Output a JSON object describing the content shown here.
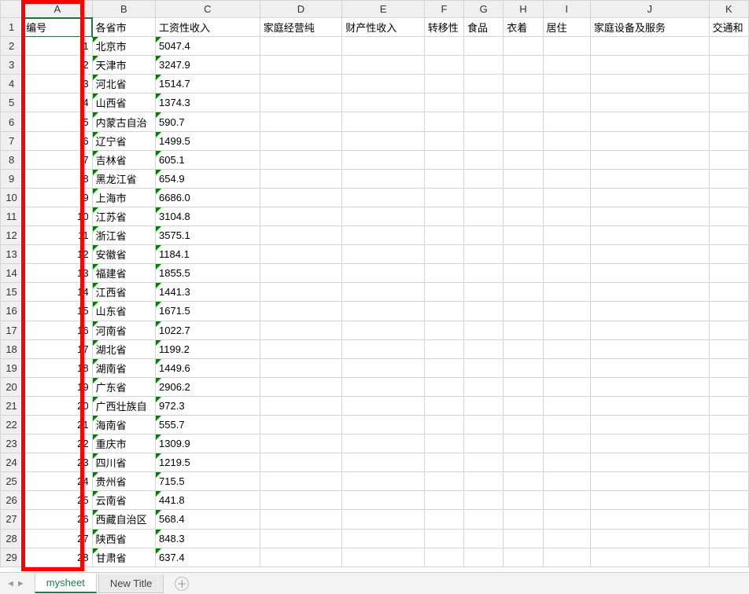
{
  "columns": [
    "A",
    "B",
    "C",
    "D",
    "E",
    "F",
    "G",
    "H",
    "I",
    "J",
    "K"
  ],
  "headerRow": {
    "A": "编号",
    "B": "各省市",
    "C": "工资性收入",
    "D": "家庭经营纯",
    "E": "财产性收入",
    "F": "转移性",
    "G": "食品",
    "H": "衣着",
    "I": "居住",
    "J": "家庭设备及服务",
    "K": "交通和"
  },
  "rows": [
    {
      "n": 1,
      "A": 1,
      "B": "北京市",
      "C": "5047.4"
    },
    {
      "n": 2,
      "A": 2,
      "B": "天津市",
      "C": "3247.9"
    },
    {
      "n": 3,
      "A": 3,
      "B": "河北省",
      "C": "1514.7"
    },
    {
      "n": 4,
      "A": 4,
      "B": "山西省",
      "C": "1374.3"
    },
    {
      "n": 5,
      "A": 5,
      "B": "内蒙古自治",
      "C": "590.7"
    },
    {
      "n": 6,
      "A": 6,
      "B": "辽宁省",
      "C": "1499.5"
    },
    {
      "n": 7,
      "A": 7,
      "B": "吉林省",
      "C": "605.1"
    },
    {
      "n": 8,
      "A": 8,
      "B": "黑龙江省",
      "C": "654.9"
    },
    {
      "n": 9,
      "A": 9,
      "B": "上海市",
      "C": "6686.0"
    },
    {
      "n": 10,
      "A": 10,
      "B": "江苏省",
      "C": "3104.8"
    },
    {
      "n": 11,
      "A": 11,
      "B": "浙江省",
      "C": "3575.1"
    },
    {
      "n": 12,
      "A": 12,
      "B": "安徽省",
      "C": "1184.1"
    },
    {
      "n": 13,
      "A": 13,
      "B": "福建省",
      "C": "1855.5"
    },
    {
      "n": 14,
      "A": 14,
      "B": "江西省",
      "C": "1441.3"
    },
    {
      "n": 15,
      "A": 15,
      "B": "山东省",
      "C": "1671.5"
    },
    {
      "n": 16,
      "A": 16,
      "B": "河南省",
      "C": "1022.7"
    },
    {
      "n": 17,
      "A": 17,
      "B": "湖北省",
      "C": "1199.2"
    },
    {
      "n": 18,
      "A": 18,
      "B": "湖南省",
      "C": "1449.6"
    },
    {
      "n": 19,
      "A": 19,
      "B": "广东省",
      "C": "2906.2"
    },
    {
      "n": 20,
      "A": 20,
      "B": "广西壮族自",
      "C": "972.3"
    },
    {
      "n": 21,
      "A": 21,
      "B": "海南省",
      "C": "555.7"
    },
    {
      "n": 22,
      "A": 22,
      "B": "重庆市",
      "C": "1309.9"
    },
    {
      "n": 23,
      "A": 23,
      "B": "四川省",
      "C": "1219.5"
    },
    {
      "n": 24,
      "A": 24,
      "B": "贵州省",
      "C": "715.5"
    },
    {
      "n": 25,
      "A": 25,
      "B": "云南省",
      "C": "441.8"
    },
    {
      "n": 26,
      "A": 26,
      "B": "西藏自治区",
      "C": "568.4"
    },
    {
      "n": 27,
      "A": 27,
      "B": "陕西省",
      "C": "848.3"
    },
    {
      "n": 28,
      "A": 28,
      "B": "甘肃省",
      "C": "637.4"
    }
  ],
  "tabs": {
    "active": "mysheet",
    "other": "New Title"
  }
}
